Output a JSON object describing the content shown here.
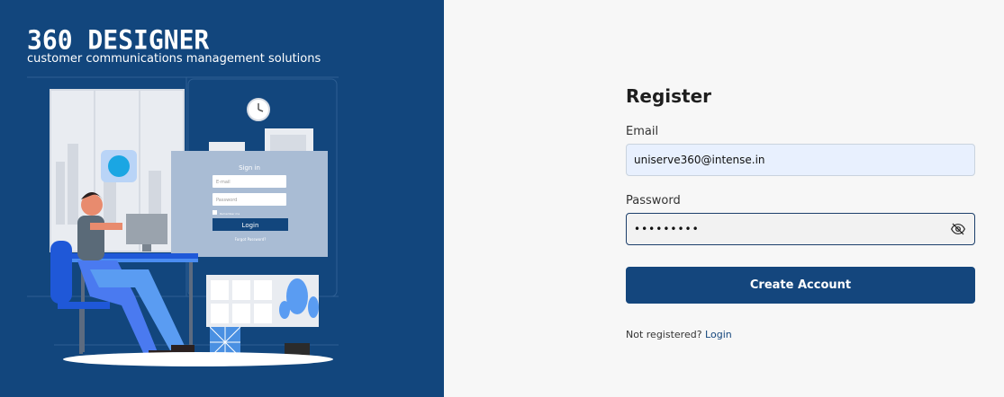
{
  "brand": {
    "title": "360 DESIGNER",
    "subtitle": "customer communications management solutions"
  },
  "illustration": {
    "sign_in_title": "Sign in",
    "email_placeholder": "E-mail",
    "password_placeholder": "Password",
    "remember_label": "Remember me",
    "login_button": "Login",
    "forgot_link": "Forgot Password?"
  },
  "form": {
    "title": "Register",
    "email_label": "Email",
    "email_value": "uniserve360@intense.in",
    "password_label": "Password",
    "password_value": "•••••••••",
    "submit_label": "Create Account",
    "footer_text": "Not registered?",
    "footer_link": "Login"
  },
  "colors": {
    "brand_blue": "#12467d",
    "button_blue": "#14467d",
    "accent_light_blue": "#5a9cf2"
  }
}
